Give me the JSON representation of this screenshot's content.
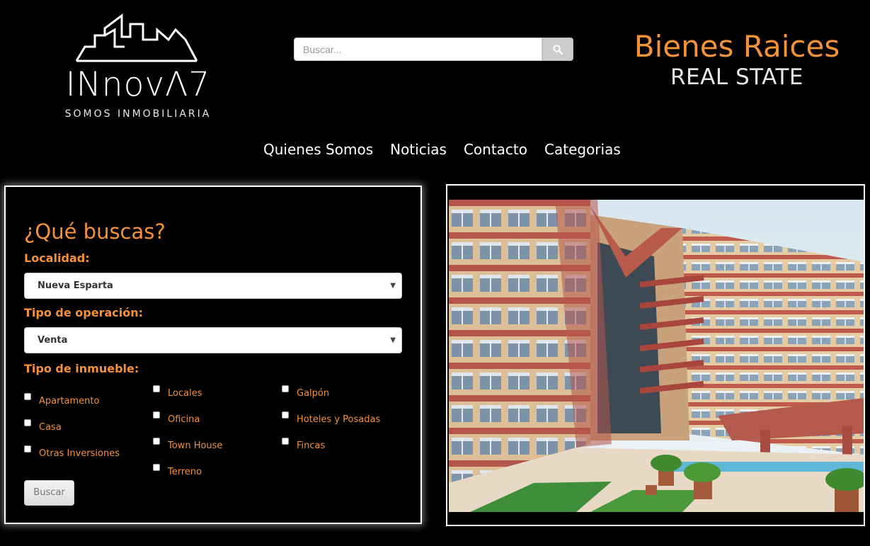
{
  "logo": {
    "wordmark": "INnovΛ7",
    "tagline": "SOMOS INMOBILIARIA"
  },
  "search": {
    "placeholder": "Buscar...",
    "icon": "search-icon"
  },
  "brand": {
    "title": "Bienes Raices",
    "subtitle": "REAL STATE",
    "accent_color": "#f4923a"
  },
  "nav": {
    "items": [
      {
        "label": "Quienes Somos"
      },
      {
        "label": "Noticias"
      },
      {
        "label": "Contacto"
      },
      {
        "label": "Categorias"
      }
    ]
  },
  "search_form": {
    "heading": "¿Qué buscas?",
    "localidad_label": "Localidad:",
    "localidad_value": "Nueva Esparta",
    "operacion_label": "Tipo de operación:",
    "operacion_value": "Venta",
    "inmueble_label": "Tipo de inmueble:",
    "options": [
      {
        "label": "Apartamento",
        "checked": false
      },
      {
        "label": "Casa",
        "checked": false
      },
      {
        "label": "Otras Inversiones",
        "checked": false
      },
      {
        "label": "Locales",
        "checked": false
      },
      {
        "label": "Oficina",
        "checked": false
      },
      {
        "label": "Town House",
        "checked": false
      },
      {
        "label": "Terreno",
        "checked": false
      },
      {
        "label": "Galpón",
        "checked": false
      },
      {
        "label": "Hoteles y Posadas",
        "checked": false
      },
      {
        "label": "Fincas",
        "checked": false
      }
    ],
    "submit_label": "Buscar"
  },
  "photo": {
    "subject": "apartment-building-photo"
  }
}
